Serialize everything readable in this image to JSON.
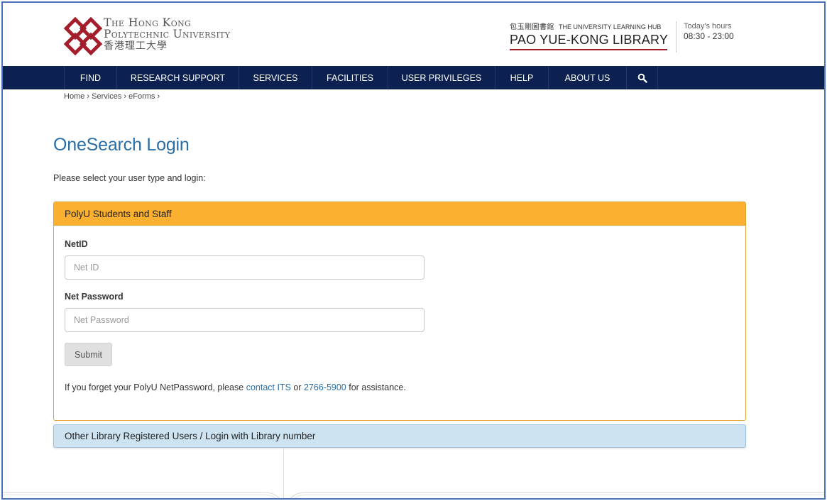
{
  "header": {
    "university": {
      "line1": "The Hong Kong",
      "line2": "Polytechnic University",
      "line3": "香港理工大學"
    },
    "library": {
      "zh": "包玉剛圖書館",
      "tagline": "THE UNIVERSITY LEARNING HUB",
      "name": "PAO YUE-KONG LIBRARY"
    },
    "hours": {
      "label": "Today's hours",
      "value": "08:30 - 23:00"
    }
  },
  "nav": {
    "items": [
      {
        "label": "FIND"
      },
      {
        "label": "RESEARCH SUPPORT"
      },
      {
        "label": "SERVICES"
      },
      {
        "label": "FACILITIES"
      },
      {
        "label": "USER PRIVILEGES"
      },
      {
        "label": "HELP"
      },
      {
        "label": "ABOUT US"
      }
    ],
    "search_icon": "search-icon"
  },
  "breadcrumb": {
    "home": "Home",
    "services": "Services",
    "eforms": "eForms",
    "sep": "›"
  },
  "page": {
    "title": "OneSearch Login",
    "intro": "Please select your user type and login:"
  },
  "panel_polyu": {
    "heading": "PolyU Students and Staff",
    "netid_label": "NetID",
    "netid_placeholder": "Net ID",
    "password_label": "Net Password",
    "password_placeholder": "Net Password",
    "submit_label": "Submit",
    "help_prefix": "If you forget your PolyU NetPassword, please ",
    "help_link1": "contact ITS",
    "help_mid": " or ",
    "help_link2": "2766-5900",
    "help_suffix": " for assistance."
  },
  "panel_other": {
    "heading": "Other Library Registered Users / Login with Library number"
  },
  "colors": {
    "nav_bg": "#0c2150",
    "title": "#2a6ea6",
    "panel_head": "#fbb030",
    "panel2_bg": "#cde3f2",
    "brand_red": "#a31d2a"
  }
}
